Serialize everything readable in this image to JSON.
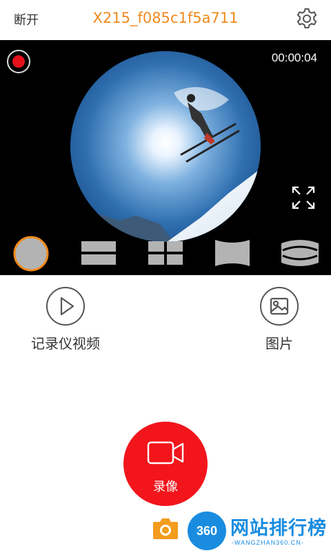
{
  "header": {
    "disconnect_label": "断开",
    "device_name": "X215_f085c1f5a711",
    "accent_color": "#f08a1d"
  },
  "preview": {
    "recording_indicator": "red-dot-icon",
    "timer": "00:00:04",
    "expand_icon": "fullscreen-icon",
    "view_modes": [
      "circle-view-icon",
      "dual-view-icon",
      "quad-view-icon",
      "panorama-view-icon",
      "cylinder-view-icon"
    ],
    "selected_mode": "circle-view-icon"
  },
  "actions": {
    "recorder_video_label": "记录仪视频",
    "pictures_label": "图片"
  },
  "record": {
    "label": "录像",
    "color": "#f2151c"
  },
  "snapshot": {
    "icon": "camera-icon",
    "color": "#f39c1e"
  },
  "watermark": {
    "logo": "360",
    "text": "网站排行榜",
    "sub": "-WANGZHAN360.CN-"
  }
}
